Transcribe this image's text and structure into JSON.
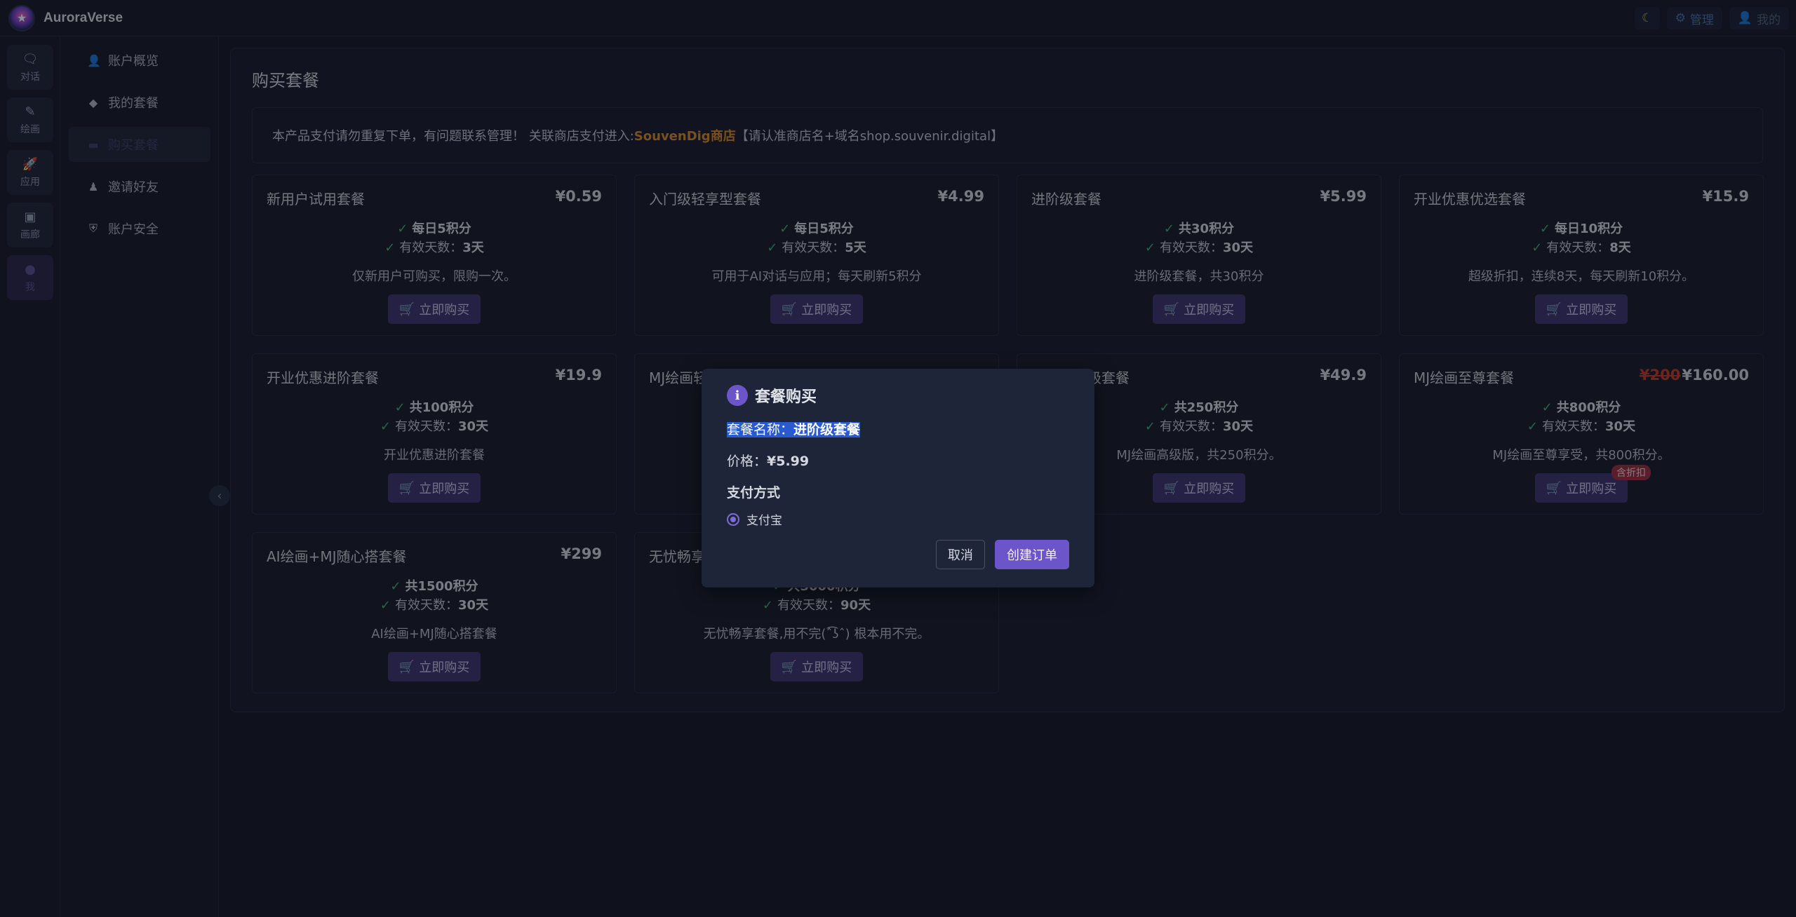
{
  "app": {
    "title": "AuroraVerse"
  },
  "topbar": {
    "admin_label": "管理",
    "mine_label": "我的"
  },
  "rail": [
    {
      "label": "对话",
      "icon": "chat-icon"
    },
    {
      "label": "绘画",
      "icon": "paint-icon"
    },
    {
      "label": "应用",
      "icon": "rocket-icon"
    },
    {
      "label": "画廊",
      "icon": "gallery-icon"
    },
    {
      "label": "我",
      "icon": "user-icon"
    }
  ],
  "sidebar": [
    {
      "label": "账户概览",
      "icon": "user-icon"
    },
    {
      "label": "我的套餐",
      "icon": "diamond-icon"
    },
    {
      "label": "购买套餐",
      "icon": "card-icon"
    },
    {
      "label": "邀请好友",
      "icon": "invite-icon"
    },
    {
      "label": "账户安全",
      "icon": "shield-icon"
    }
  ],
  "page": {
    "title": "购买套餐",
    "notice_prefix": "本产品支付请勿重复下单，有问题联系管理！ 关联商店支付进入:",
    "notice_shop": "SouvenDig商店",
    "notice_suffix": "【请认准商店名+域名shop.souvenir.digital】"
  },
  "buy_label": "立即购买",
  "discount_label": "含折扣",
  "packages": [
    {
      "name": "新用户试用套餐",
      "price": "¥0.59",
      "points": "每日5积分",
      "days_label": "有效天数：",
      "days": "3天",
      "desc": "仅新用户可购买，限购一次。"
    },
    {
      "name": "入门级轻享型套餐",
      "price": "¥4.99",
      "points": "每日5积分",
      "days_label": "有效天数：",
      "days": "5天",
      "desc": "可用于AI对话与应用；每天刷新5积分"
    },
    {
      "name": "进阶级套餐",
      "price": "¥5.99",
      "points": "共30积分",
      "days_label": "有效天数：",
      "days": "30天",
      "desc": "进阶级套餐，共30积分"
    },
    {
      "name": "开业优惠优选套餐",
      "price": "¥15.9",
      "points": "每日10积分",
      "days_label": "有效天数：",
      "days": "8天",
      "desc": "超级折扣，连续8天，每天刷新10积分。"
    },
    {
      "name": "开业优惠进阶套餐",
      "price": "¥19.9",
      "points": "共100积分",
      "days_label": "有效天数：",
      "days": "30天",
      "desc": "开业优惠进阶套餐"
    },
    {
      "name": "MJ绘画轻",
      "price": "",
      "points": "",
      "days_label": "",
      "days": "",
      "desc": ""
    },
    {
      "name": "级套餐",
      "price": "¥49.9",
      "points": "共250积分",
      "days_label": "有效天数：",
      "days": "30天",
      "desc": "MJ绘画高级版，共250积分。"
    },
    {
      "name": "MJ绘画至尊套餐",
      "old_price": "¥200",
      "price": "¥160.00",
      "points": "共800积分",
      "days_label": "有效天数：",
      "days": "30天",
      "desc": "MJ绘画至尊享受，共800积分。"
    },
    {
      "name": "AI绘画+MJ随心搭套餐",
      "price": "¥299",
      "points": "共1500积分",
      "days_label": "有效天数：",
      "days": "30天",
      "desc": "AI绘画+MJ随心搭套餐"
    },
    {
      "name": "无忧畅享",
      "price": "",
      "points": "共3000积分",
      "days_label": "有效天数：",
      "days": "90天",
      "desc": "无忧畅享套餐,用不完(ˆ͡ʖˆ) 根本用不完。"
    }
  ],
  "dialog": {
    "title": "套餐购买",
    "name_label": "套餐名称：",
    "name_value": "进阶级套餐",
    "price_label": "价格：",
    "price_value": "¥5.99",
    "pay_method_label": "支付方式",
    "pay_option": "支付宝",
    "cancel_label": "取消",
    "create_label": "创建订单"
  },
  "colors": {
    "accent": "#6b55c8",
    "check": "#3fae7a",
    "shop_link": "#d9892a",
    "discount": "#9a2f3e"
  }
}
